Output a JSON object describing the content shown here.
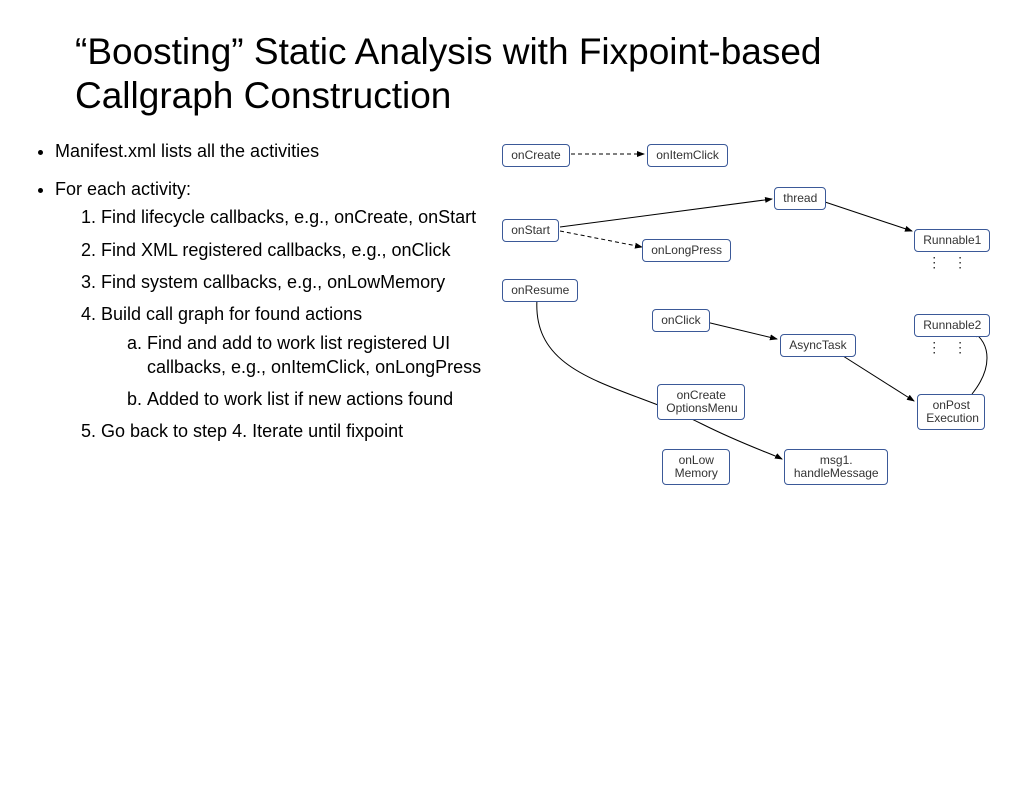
{
  "title": "“Boosting” Static Analysis with Fixpoint-based Callgraph Construction",
  "bullets": {
    "b1": "Manifest.xml lists all the activities",
    "b2": "For each activity:",
    "steps": {
      "s1": "Find lifecycle callbacks, e.g., onCreate, onStart",
      "s2": "Find XML registered callbacks, e.g., onClick",
      "s3": "Find system callbacks, e.g., onLowMemory",
      "s4": "Build call graph for found actions",
      "s4a": "Find and add to work list registered UI callbacks, e.g., onItemClick, onLongPress",
      "s4b": "Added to work list if new actions found",
      "s5": "Go back to step 4. Iterate until fixpoint"
    }
  },
  "nodes": {
    "onCreate": "onCreate",
    "onItemClick": "onItemClick",
    "onStart": "onStart",
    "thread": "thread",
    "Runnable1": "Runnable1",
    "onLongPress": "onLongPress",
    "onResume": "onResume",
    "onClick": "onClick",
    "AsyncTask": "AsyncTask",
    "Runnable2": "Runnable2",
    "onCreateOptionsMenu": "onCreate\nOptionsMenu",
    "onLowMemory": "onLow\nMemory",
    "msg1handleMessage": "msg1.\nhandleMessage",
    "onPostExecution": "onPost\nExecution"
  }
}
